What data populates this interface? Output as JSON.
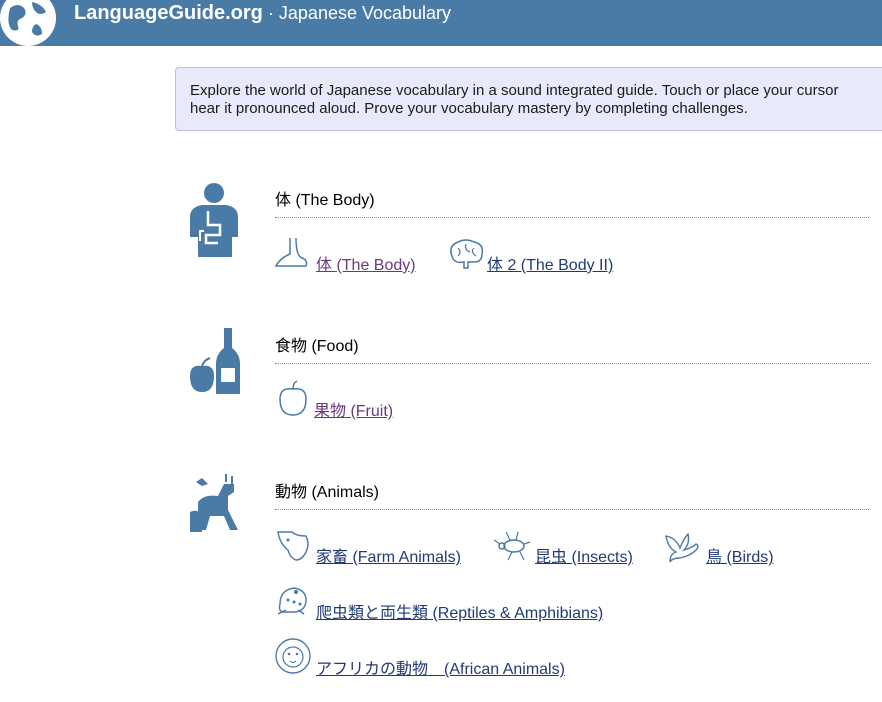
{
  "header": {
    "brand": "LanguageGuide.org",
    "separator": " · ",
    "subtitle": "Japanese Vocabulary"
  },
  "intro": {
    "line1": "Explore the world of Japanese vocabulary in a sound integrated guide. Touch or place your cursor",
    "line2": "hear it pronounced aloud. Prove your vocabulary mastery by completing challenges."
  },
  "categories": [
    {
      "title": "体 (The Body)",
      "icon": "human-body-icon",
      "links": [
        {
          "label": " 体 (The Body)",
          "icon": "foot-icon"
        },
        {
          "label": " 体 2 (The Body II)",
          "icon": "brain-icon"
        }
      ]
    },
    {
      "title": "食物 (Food)",
      "icon": "food-icon",
      "links": [
        {
          "label": " 果物 (Fruit)",
          "icon": "apple-icon"
        }
      ]
    },
    {
      "title": "動物 (Animals)",
      "icon": "animals-icon",
      "links": [
        {
          "label": " 家畜 (Farm Animals)",
          "icon": "cow-icon"
        },
        {
          "label": " 昆虫 (Insects)",
          "icon": "insect-icon"
        },
        {
          "label": " 鳥 (Birds)",
          "icon": "bird-icon"
        },
        {
          "label": " 爬虫類と両生類 (Reptiles & Amphibians)",
          "icon": "frog-icon"
        },
        {
          "label": " アフリカの動物　(African Animals)",
          "icon": "lion-icon"
        }
      ]
    }
  ],
  "colors": {
    "header_bg": "#4a7aa6",
    "icon_blue": "#4a7aa6",
    "link": "#203a78",
    "visited": "#6a3a7e",
    "intro_bg": "#e8e9fb"
  }
}
